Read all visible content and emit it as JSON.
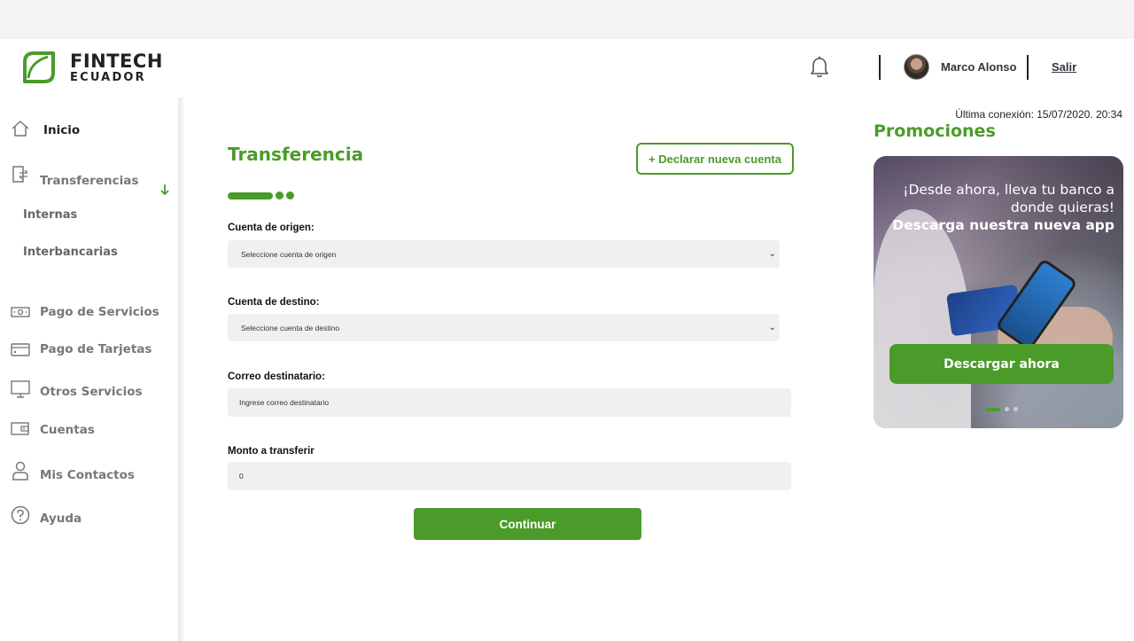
{
  "brand": {
    "line1": "FINTECH",
    "line2": "ECUADOR",
    "color": "#4b9b2a"
  },
  "header": {
    "user_name": "Marco Alonso",
    "logout_label": "Salir",
    "icons": [
      "bell-icon",
      "user-avatar"
    ]
  },
  "sidebar": {
    "items": [
      {
        "label": "Inicio",
        "icon": "home-icon",
        "active": true
      },
      {
        "label": "Transferencias",
        "icon": "transfer-icon",
        "expanded": true
      },
      {
        "label": "Pago de Servicios",
        "icon": "money-bill-icon"
      },
      {
        "label": "Pago de Tarjetas",
        "icon": "credit-card-icon"
      },
      {
        "label": "Otros Servicios",
        "icon": "monitor-icon"
      },
      {
        "label": "Cuentas",
        "icon": "wallet-icon"
      },
      {
        "label": "Mis Contactos",
        "icon": "user-icon"
      },
      {
        "label": "Ayuda",
        "icon": "help-icon"
      }
    ],
    "subitems": [
      {
        "label": "Internas"
      },
      {
        "label": "Interbancarias"
      }
    ]
  },
  "main": {
    "last_connection": "Última conexión: 15/07/2020. 20:34",
    "title": "Transferencia",
    "new_account_button": "+ Declarar nueva cuenta",
    "form": {
      "origin_label": "Cuenta de origen:",
      "origin_value": "Seleccione cuenta de origen",
      "destination_label": "Cuenta de destino:",
      "destination_value": "Seleccione cuenta de destino",
      "email_label": "Correo destinatario:",
      "email_placeholder": "Ingrese correo destinatario",
      "amount_label": "Monto a transferir",
      "amount_value": "0",
      "continue_label": "Continuar"
    }
  },
  "promo": {
    "title": "Promociones",
    "text_line1": "¡Desde ahora, lleva tu banco a donde quieras!",
    "text_line2": "Descarga nuestra nueva app",
    "button_label": "Descargar ahora",
    "slides": 3,
    "active_slide": 1
  }
}
